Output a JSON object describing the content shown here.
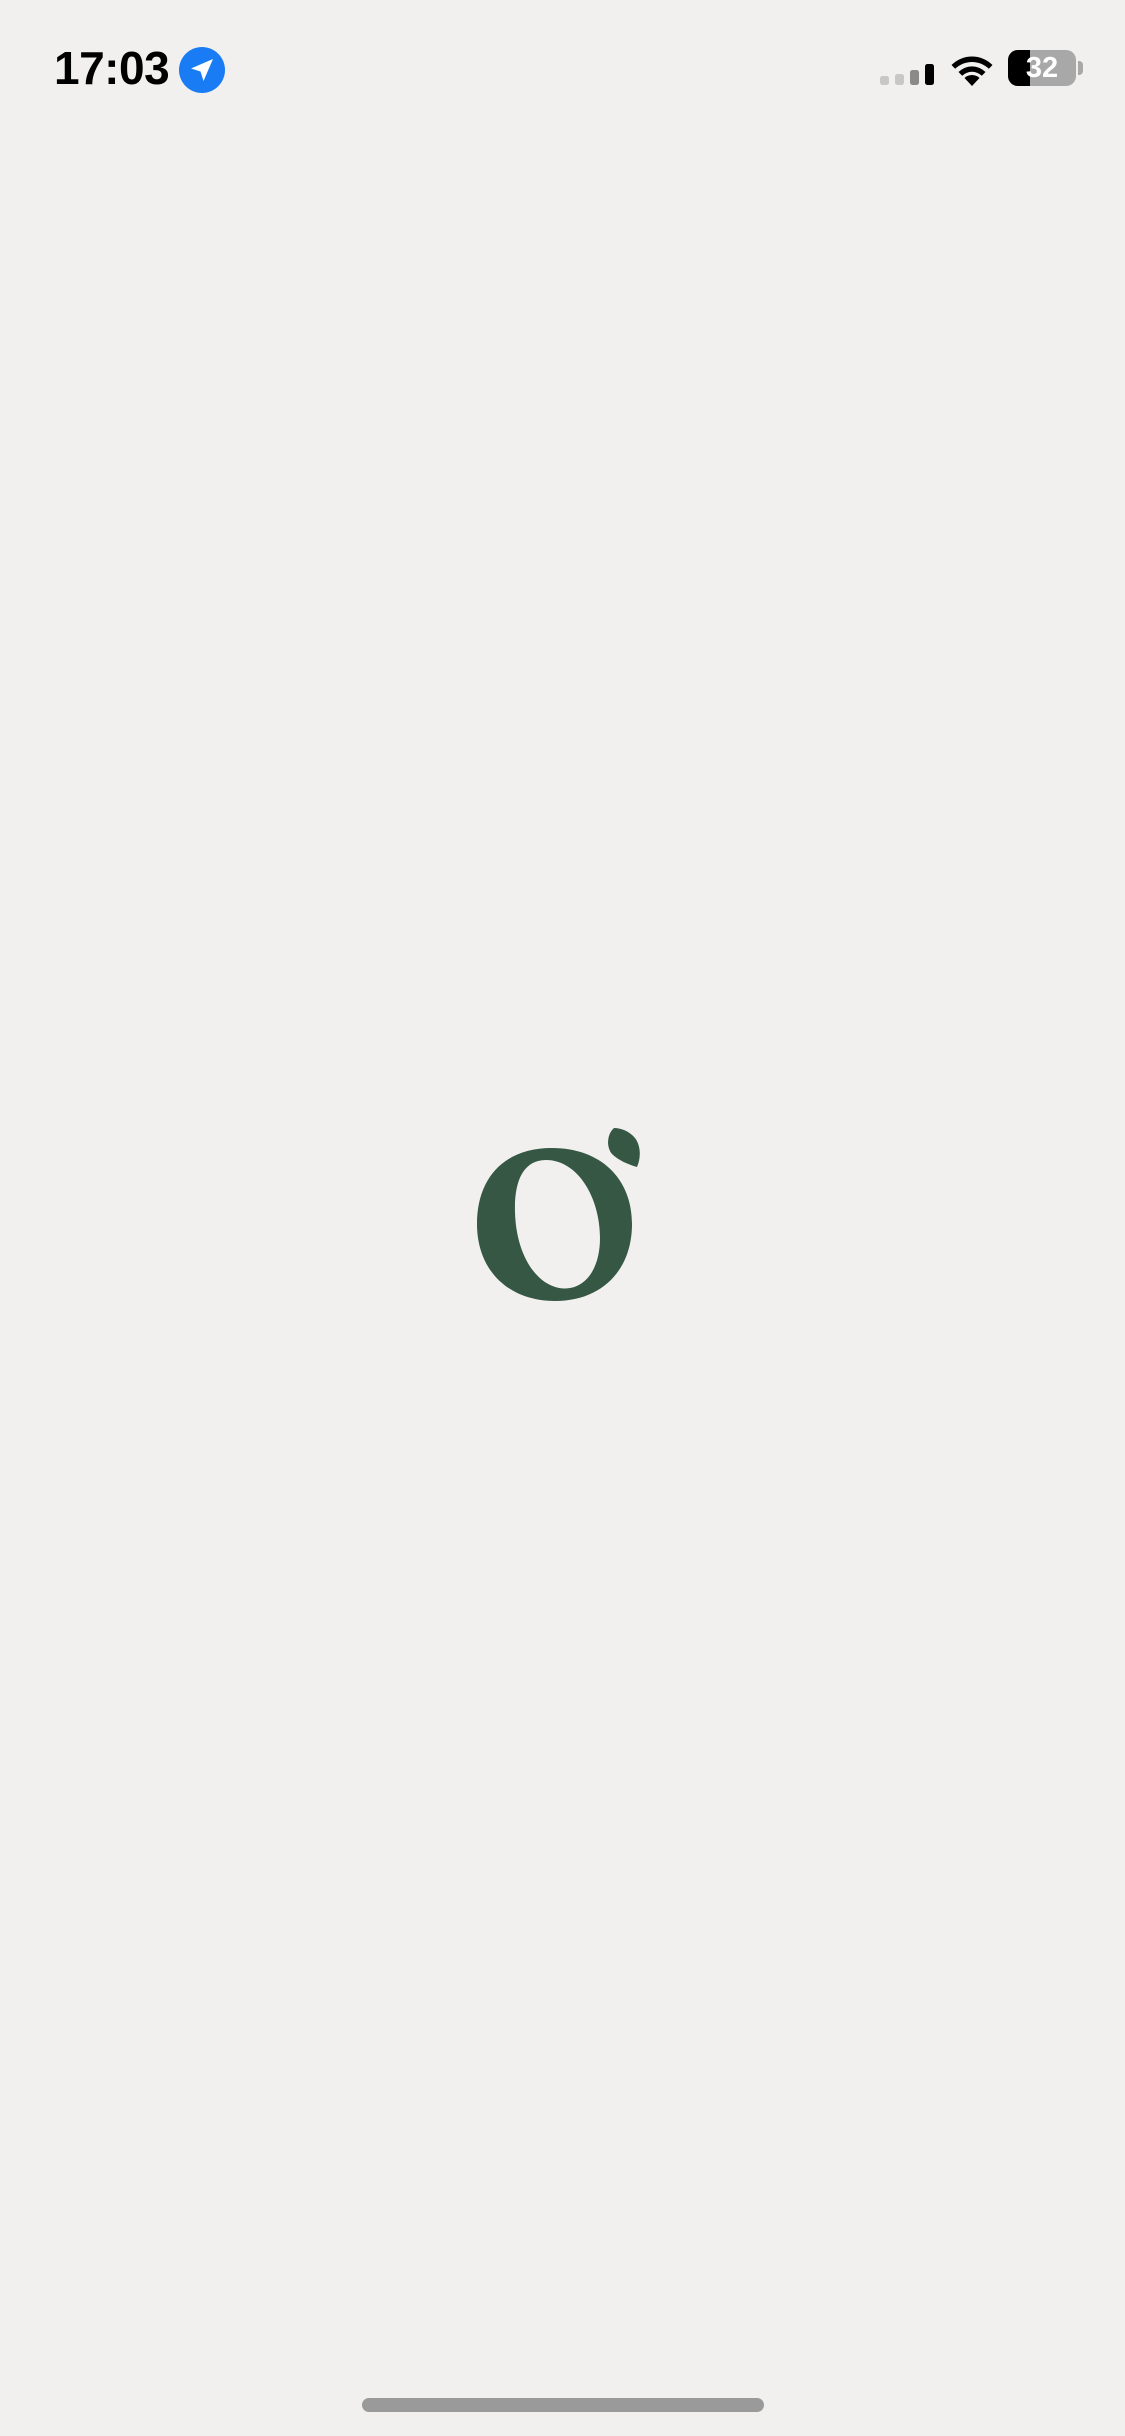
{
  "status_bar": {
    "time": "17:03",
    "location_icon": "location-arrow-icon",
    "signal_icon": "cellular-signal-icon",
    "signal_bars_active": 2,
    "signal_bars_total": 4,
    "wifi_icon": "wifi-icon",
    "battery_icon": "battery-icon",
    "battery_level": "32",
    "battery_fraction": 0.32
  },
  "splash": {
    "logo_icon": "leaf-o-logo-icon"
  },
  "colors": {
    "background": "#f1f0ee",
    "brand_green": "#355744",
    "location_blue": "#1a7cf5",
    "text": "#000000"
  },
  "home_indicator": "home-indicator"
}
